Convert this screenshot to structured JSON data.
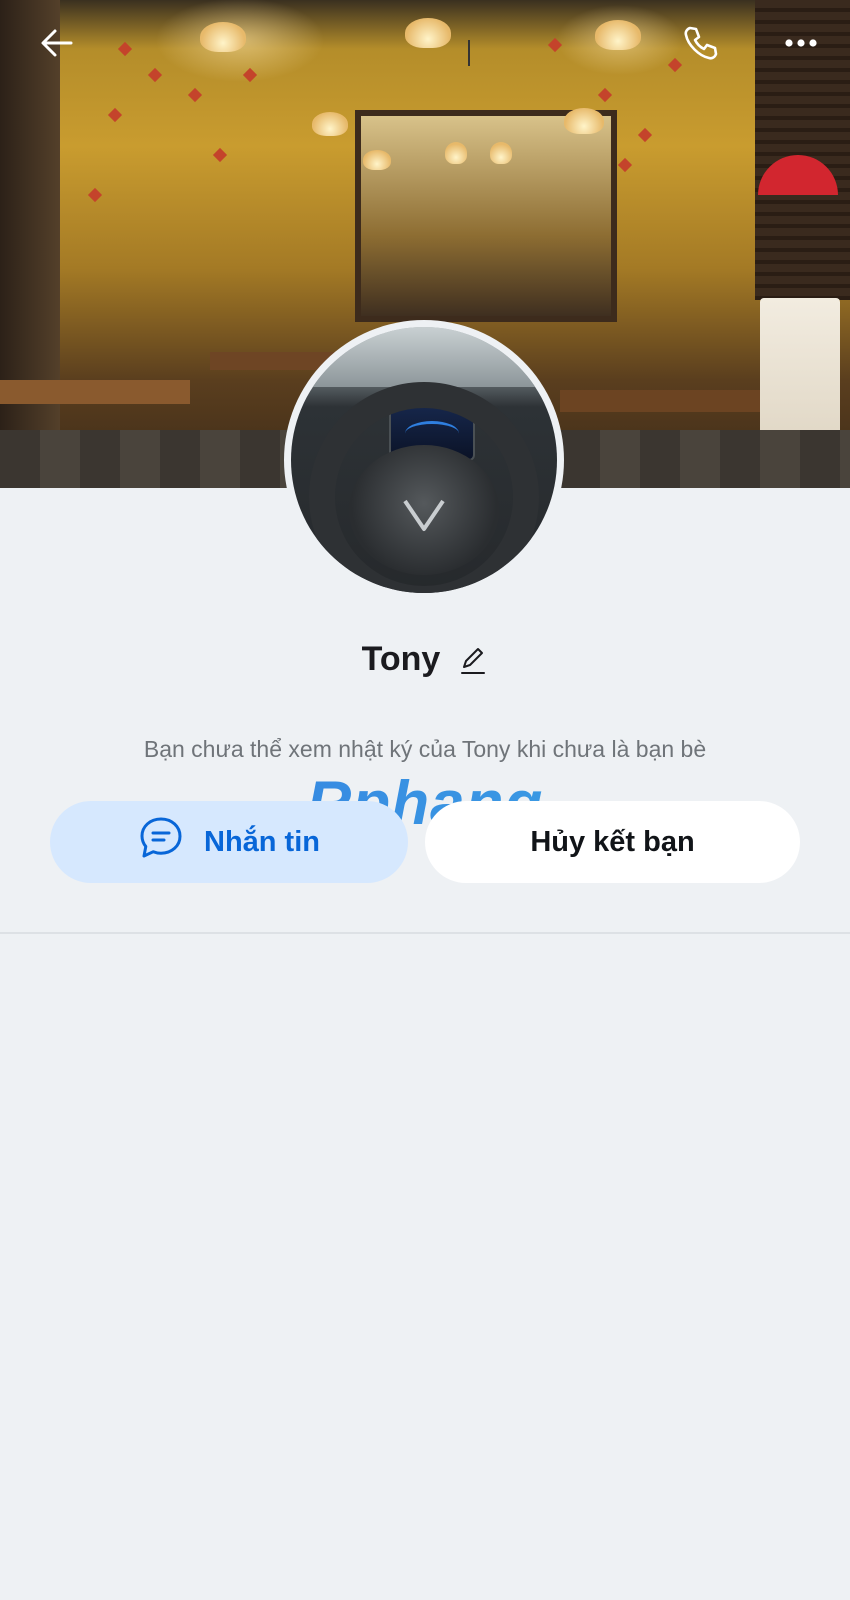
{
  "cover": {
    "alt": "Ảnh bìa quán cà phê",
    "icons": {
      "back": "back-arrow-icon",
      "call": "phone-icon",
      "more": "more-dots-icon"
    }
  },
  "profile": {
    "name": "Tony",
    "edit_icon": "pencil-icon",
    "notice": "Bạn chưa thể xem nhật ký của Tony khi chưa là bạn bè"
  },
  "watermark": "Rphang",
  "actions": {
    "message_label": "Nhắn tin",
    "message_icon": "chat-bubble-icon",
    "unfriend_label": "Hủy kết bạn"
  },
  "colors": {
    "accent": "#0866d8",
    "message_button_bg": "#d6e8fe",
    "page_bg": "#eef1f4"
  }
}
